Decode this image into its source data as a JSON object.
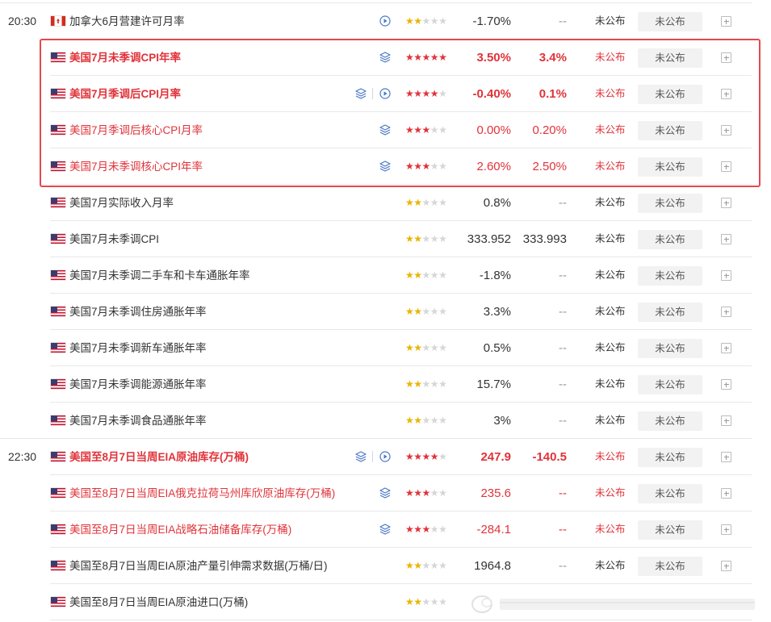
{
  "colors": {
    "highlight": "#e5484d",
    "important_text": "#e0333a",
    "star_gold": "#e9b500",
    "star_off": "#d6d6d6",
    "icon_blue": "#4a78c8"
  },
  "rows": [
    {
      "time": "20:30",
      "flag": "ca-flag",
      "name": "加拿大6月营建许可月率",
      "icons": [
        "play-icon"
      ],
      "stars": 2,
      "prev": "-1.70%",
      "pred": "--",
      "actual": "未公布",
      "btn": "未公布",
      "red": false,
      "bold": false
    },
    {
      "time": "",
      "flag": "us-flag",
      "name": "美国7月未季调CPI年率",
      "icons": [
        "layers-icon"
      ],
      "stars": 5,
      "prev": "3.50%",
      "pred": "3.4%",
      "actual": "未公布",
      "btn": "未公布",
      "red": true,
      "bold": true
    },
    {
      "time": "",
      "flag": "us-flag",
      "name": "美国7月季调后CPI月率",
      "icons": [
        "layers-icon",
        "play-icon"
      ],
      "stars": 4,
      "prev": "-0.40%",
      "pred": "0.1%",
      "actual": "未公布",
      "btn": "未公布",
      "red": true,
      "bold": true
    },
    {
      "time": "",
      "flag": "us-flag",
      "name": "美国7月季调后核心CPI月率",
      "icons": [
        "layers-icon"
      ],
      "stars": 3,
      "prev": "0.00%",
      "pred": "0.20%",
      "actual": "未公布",
      "btn": "未公布",
      "red": true,
      "bold": false
    },
    {
      "time": "",
      "flag": "us-flag",
      "name": "美国7月未季调核心CPI年率",
      "icons": [
        "layers-icon"
      ],
      "stars": 3,
      "prev": "2.60%",
      "pred": "2.50%",
      "actual": "未公布",
      "btn": "未公布",
      "red": true,
      "bold": false
    },
    {
      "time": "",
      "flag": "us-flag",
      "name": "美国7月实际收入月率",
      "icons": [],
      "stars": 2,
      "prev": "0.8%",
      "pred": "--",
      "actual": "未公布",
      "btn": "未公布",
      "red": false,
      "bold": false
    },
    {
      "time": "",
      "flag": "us-flag",
      "name": "美国7月未季调CPI",
      "icons": [],
      "stars": 2,
      "prev": "333.952",
      "pred": "333.993",
      "actual": "未公布",
      "btn": "未公布",
      "red": false,
      "bold": false
    },
    {
      "time": "",
      "flag": "us-flag",
      "name": "美国7月未季调二手车和卡车通胀年率",
      "icons": [],
      "stars": 2,
      "prev": "-1.8%",
      "pred": "--",
      "actual": "未公布",
      "btn": "未公布",
      "red": false,
      "bold": false
    },
    {
      "time": "",
      "flag": "us-flag",
      "name": "美国7月未季调住房通胀年率",
      "icons": [],
      "stars": 2,
      "prev": "3.3%",
      "pred": "--",
      "actual": "未公布",
      "btn": "未公布",
      "red": false,
      "bold": false
    },
    {
      "time": "",
      "flag": "us-flag",
      "name": "美国7月未季调新车通胀年率",
      "icons": [],
      "stars": 2,
      "prev": "0.5%",
      "pred": "--",
      "actual": "未公布",
      "btn": "未公布",
      "red": false,
      "bold": false
    },
    {
      "time": "",
      "flag": "us-flag",
      "name": "美国7月未季调能源通胀年率",
      "icons": [],
      "stars": 2,
      "prev": "15.7%",
      "pred": "--",
      "actual": "未公布",
      "btn": "未公布",
      "red": false,
      "bold": false
    },
    {
      "time": "",
      "flag": "us-flag",
      "name": "美国7月未季调食品通胀年率",
      "icons": [],
      "stars": 2,
      "prev": "3%",
      "pred": "--",
      "actual": "未公布",
      "btn": "未公布",
      "red": false,
      "bold": false
    },
    {
      "time": "22:30",
      "flag": "us-flag",
      "name": "美国至8月7日当周EIA原油库存(万桶)",
      "icons": [
        "layers-icon",
        "play-icon"
      ],
      "stars": 4,
      "prev": "247.9",
      "pred": "-140.5",
      "actual": "未公布",
      "btn": "未公布",
      "red": true,
      "bold": true
    },
    {
      "time": "",
      "flag": "us-flag",
      "name": "美国至8月7日当周EIA俄克拉荷马州库欣原油库存(万桶)",
      "icons": [
        "layers-icon"
      ],
      "stars": 3,
      "prev": "235.6",
      "pred": "--",
      "actual": "未公布",
      "btn": "未公布",
      "red": true,
      "bold": false
    },
    {
      "time": "",
      "flag": "us-flag",
      "name": "美国至8月7日当周EIA战略石油储备库存(万桶)",
      "icons": [
        "layers-icon"
      ],
      "stars": 3,
      "prev": "-284.1",
      "pred": "--",
      "actual": "未公布",
      "btn": "未公布",
      "red": true,
      "bold": false
    },
    {
      "time": "",
      "flag": "us-flag",
      "name": "美国至8月7日当周EIA原油产量引伸需求数据(万桶/日)",
      "icons": [],
      "stars": 2,
      "prev": "1964.8",
      "pred": "--",
      "actual": "未公布",
      "btn": "未公布",
      "red": false,
      "bold": false
    },
    {
      "time": "",
      "flag": "us-flag",
      "name": "美国至8月7日当周EIA原油进口(万桶)",
      "icons": [],
      "stars": 2,
      "prev": "",
      "pred": "",
      "actual": "",
      "btn": "",
      "red": false,
      "bold": false
    }
  ]
}
